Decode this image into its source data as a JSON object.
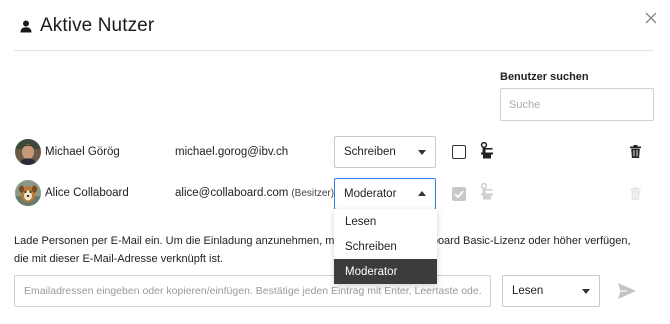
{
  "header": {
    "title": "Aktive Nutzer"
  },
  "search": {
    "label": "Benutzer suchen",
    "placeholder": "Suche",
    "value": ""
  },
  "users": [
    {
      "name": "Michael Görög",
      "email": "michael.gorog@ibv.ch",
      "role": "Schreiben",
      "owner_tag": "",
      "checkbox_checked": false,
      "checkbox_disabled": false,
      "delete_disabled": false
    },
    {
      "name": "Alice Collaboard",
      "email": "alice@collaboard.com",
      "role": "Moderator",
      "owner_tag": "(Besitzer)",
      "checkbox_checked": true,
      "checkbox_disabled": true,
      "delete_disabled": true
    }
  ],
  "role_menu": {
    "open_for": "Alice Collaboard",
    "options": [
      "Lesen",
      "Schreiben",
      "Moderator"
    ],
    "selected": "Moderator"
  },
  "info": {
    "line1_left": "Lade Personen per E-Mail ein. Um die Einladung anzunehmen, muss d",
    "line1_right": "ollaboard Basic-Lizenz oder höher verfügen,",
    "line2": "die mit dieser E-Mail-Adresse verknüpft ist."
  },
  "invite": {
    "placeholder": "Emailadressen eingeben oder kopieren/einfügen. Bestätige jeden Eintrag mit Enter, Leertaste ode...",
    "value": "",
    "permission": "Lesen"
  },
  "icons": {
    "title": "user-icon",
    "close": "close-icon",
    "role_badge": "presenter-icon",
    "delete": "trash-icon",
    "send": "send-icon"
  },
  "colors": {
    "accent_border": "#2b7de9",
    "menu_selected_bg": "#3c3c3c",
    "disabled_icon": "#cfcfcf"
  }
}
